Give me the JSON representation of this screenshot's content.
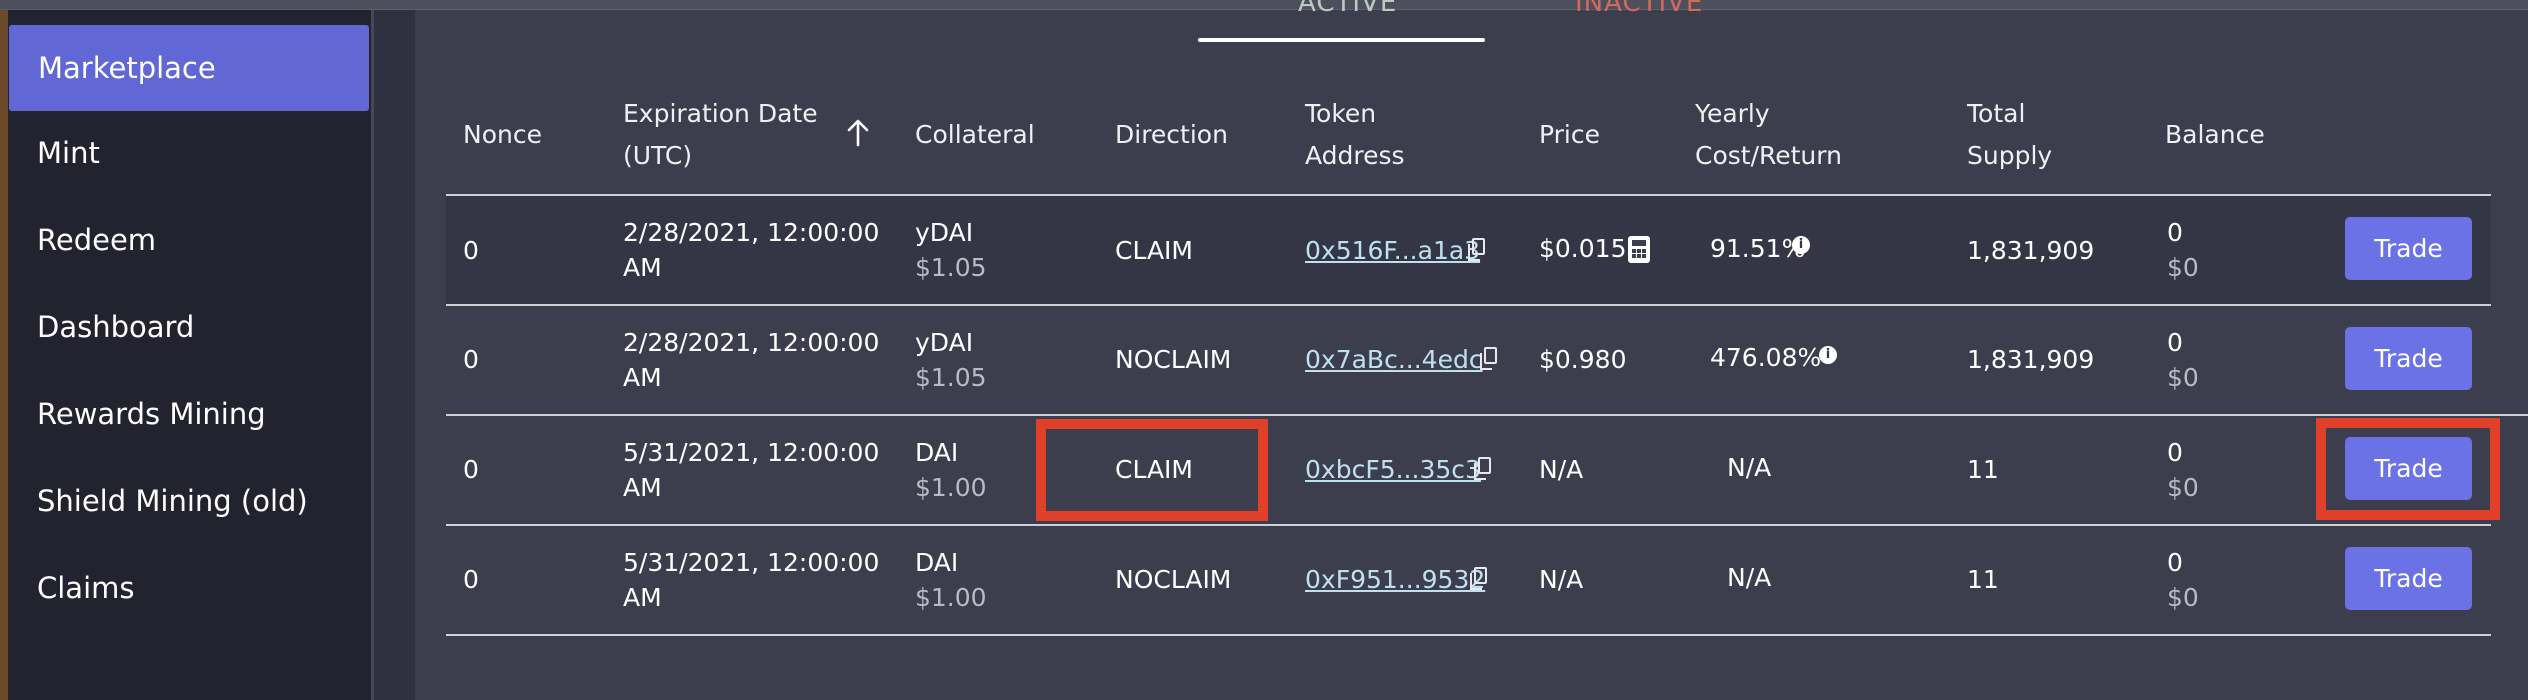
{
  "sidebar": {
    "items": [
      {
        "label": "Marketplace",
        "active": true
      },
      {
        "label": "Mint"
      },
      {
        "label": "Redeem"
      },
      {
        "label": "Dashboard"
      },
      {
        "label": "Rewards Mining"
      },
      {
        "label": "Shield Mining (old)"
      },
      {
        "label": "Claims"
      }
    ]
  },
  "tabs": {
    "active": "ACTIVE",
    "inactive": "INACTIVE"
  },
  "table": {
    "headers": {
      "nonce": "Nonce",
      "expiration_line1": "Expiration Date",
      "expiration_line2": "(UTC)",
      "collateral": "Collateral",
      "direction": "Direction",
      "token_line1": "Token",
      "token_line2": "Address",
      "price": "Price",
      "yearly_line1": "Yearly",
      "yearly_line2": "Cost/Return",
      "supply_line1": "Total",
      "supply_line2": "Supply",
      "balance": "Balance"
    },
    "rows": [
      {
        "nonce": "0",
        "exp_line1": "2/28/2021, 12:00:00",
        "exp_line2": "AM",
        "collateral": "yDAI",
        "collateral_price": "$1.05",
        "direction": "CLAIM",
        "token": "0x516F...a1a3",
        "price": "$0.015",
        "yearly": "91.51%",
        "supply": "1,831,909",
        "balance": "0",
        "balance_usd": "$0",
        "action": "Trade"
      },
      {
        "nonce": "0",
        "exp_line1": "2/28/2021, 12:00:00",
        "exp_line2": "AM",
        "collateral": "yDAI",
        "collateral_price": "$1.05",
        "direction": "NOCLAIM",
        "token": "0x7aBc...4edc",
        "price": "$0.980",
        "yearly": "476.08%",
        "supply": "1,831,909",
        "balance": "0",
        "balance_usd": "$0",
        "action": "Trade"
      },
      {
        "nonce": "0",
        "exp_line1": "5/31/2021, 12:00:00",
        "exp_line2": "AM",
        "collateral": "DAI",
        "collateral_price": "$1.00",
        "direction": "CLAIM",
        "token": "0xbcF5...35c3",
        "price": "N/A",
        "yearly": "N/A",
        "supply": "11",
        "balance": "0",
        "balance_usd": "$0",
        "action": "Trade"
      },
      {
        "nonce": "0",
        "exp_line1": "5/31/2021, 12:00:00",
        "exp_line2": "AM",
        "collateral": "DAI",
        "collateral_price": "$1.00",
        "direction": "NOCLAIM",
        "token": "0xF951...9532",
        "price": "N/A",
        "yearly": "N/A",
        "supply": "11",
        "balance": "0",
        "balance_usd": "$0",
        "action": "Trade"
      }
    ]
  },
  "icons": {
    "sort": "arrow-up-icon",
    "copy": "copy-icon",
    "info": "info-icon",
    "calculator": "calculator-icon"
  },
  "colors": {
    "accent": "#6b72e6",
    "sidebar_active": "#6168d6",
    "highlight": "#e0402a"
  }
}
